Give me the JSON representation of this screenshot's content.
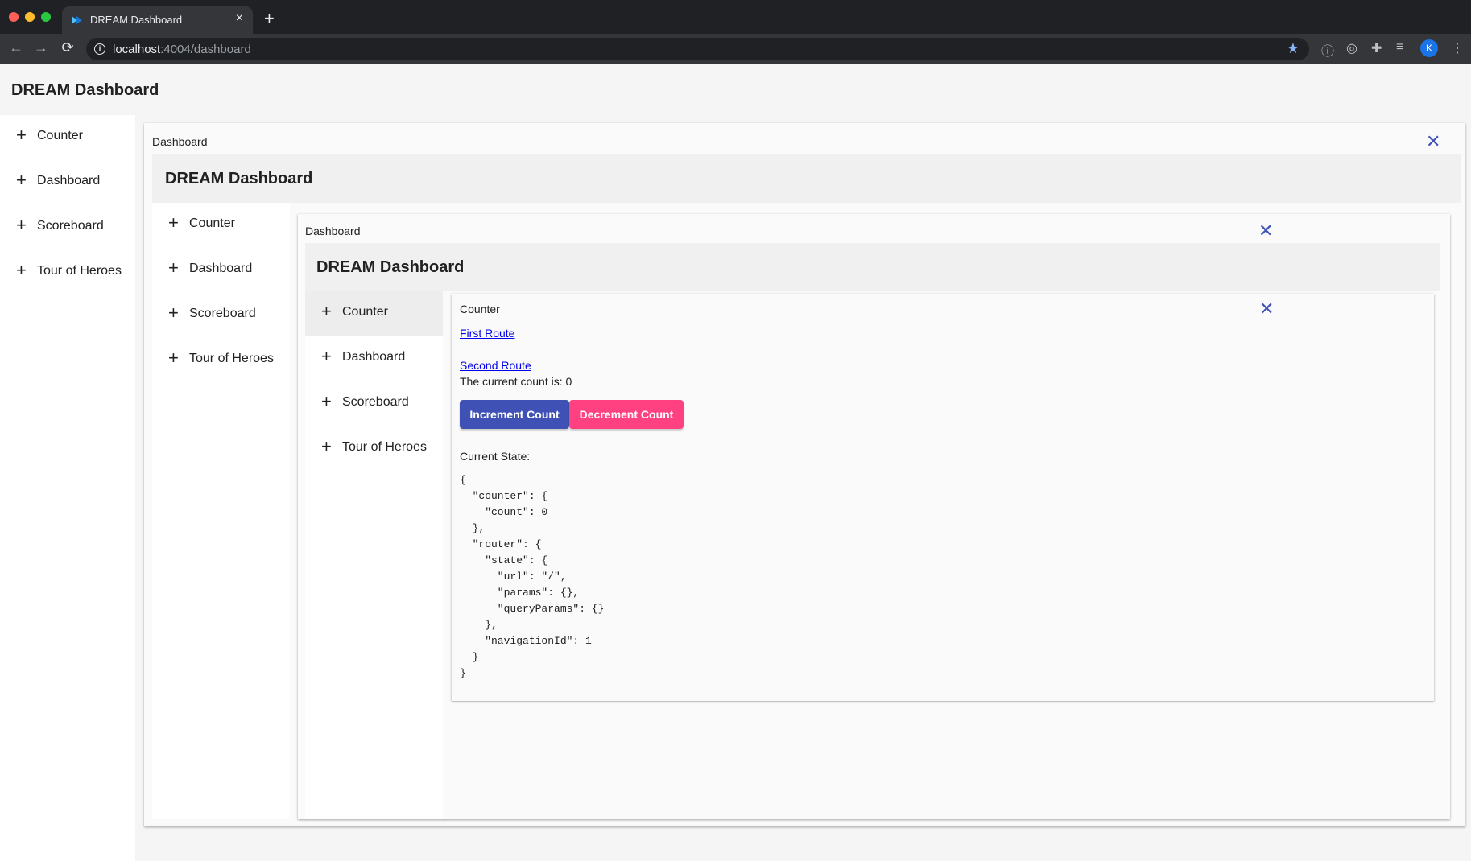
{
  "browser": {
    "tab_title": "DREAM Dashboard",
    "tab_close": "×",
    "new_tab": "+",
    "url_host": "localhost",
    "url_rest": ":4004/dashboard",
    "avatar_letter": "K"
  },
  "app": {
    "title": "DREAM Dashboard"
  },
  "nav": {
    "items": [
      {
        "icon": "plus-icon",
        "label": "Counter"
      },
      {
        "icon": "plus-icon",
        "label": "Dashboard"
      },
      {
        "icon": "plus-icon",
        "label": "Scoreboard"
      },
      {
        "icon": "plus-icon",
        "label": "Tour of Heroes"
      }
    ]
  },
  "level1": {
    "card_label": "Dashboard",
    "title": "DREAM Dashboard"
  },
  "level2": {
    "card_label": "Dashboard",
    "title": "DREAM Dashboard"
  },
  "counter": {
    "card_label": "Counter",
    "first_route": "First Route",
    "second_route": "Second Route",
    "count_text": "The current count is: 0",
    "increment_label": "Increment Count",
    "decrement_label": "Decrement Count",
    "state_label": "Current State:",
    "state_json": "{\n  \"counter\": {\n    \"count\": 0\n  },\n  \"router\": {\n    \"state\": {\n      \"url\": \"/\",\n      \"params\": {},\n      \"queryParams\": {}\n    },\n    \"navigationId\": 1\n  }\n}"
  },
  "icons": {
    "plus": "+",
    "close": "✕"
  },
  "colors": {
    "primary": "#3f51b5",
    "accent": "#ff4081"
  }
}
